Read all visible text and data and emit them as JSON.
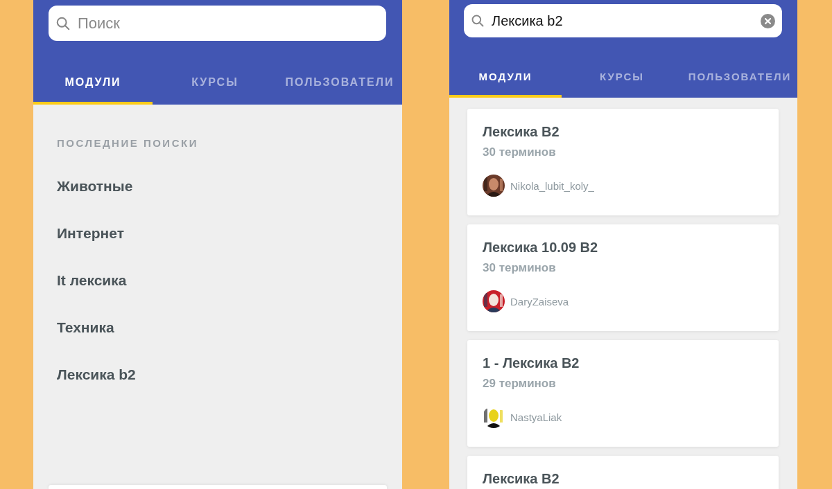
{
  "screens": [
    {
      "kind": "recent",
      "search": {
        "placeholder": "Поиск"
      },
      "tabs": [
        {
          "label": "МОДУЛИ",
          "selected": true
        },
        {
          "label": "КУРСЫ",
          "selected": false
        },
        {
          "label": "ПОЛЬЗОВАТЕЛИ",
          "selected": false
        }
      ],
      "section_title": "ПОСЛЕДНИЕ ПОИСКИ",
      "recent_searches": [
        "Животные",
        "Интернет",
        "It лексика",
        "Техника",
        "Лексика b2"
      ]
    },
    {
      "kind": "results",
      "search": {
        "value": "Лексика b2"
      },
      "tabs": [
        {
          "label": "МОДУЛИ",
          "selected": true
        },
        {
          "label": "КУРСЫ",
          "selected": false
        },
        {
          "label": "ПОЛЬЗОВАТЕЛИ",
          "selected": false
        }
      ],
      "results": [
        {
          "title": "Лексика B2",
          "terms": "30 терминов",
          "author": "Nikola_lubit_koly_"
        },
        {
          "title": "Лексика 10.09 B2",
          "terms": "30 терминов",
          "author": "DaryZaiseva"
        },
        {
          "title": "1 - Лексика B2",
          "terms": "29 терминов",
          "author": "NastyaLiak"
        },
        {
          "title": "Лексика B2"
        }
      ]
    }
  ]
}
